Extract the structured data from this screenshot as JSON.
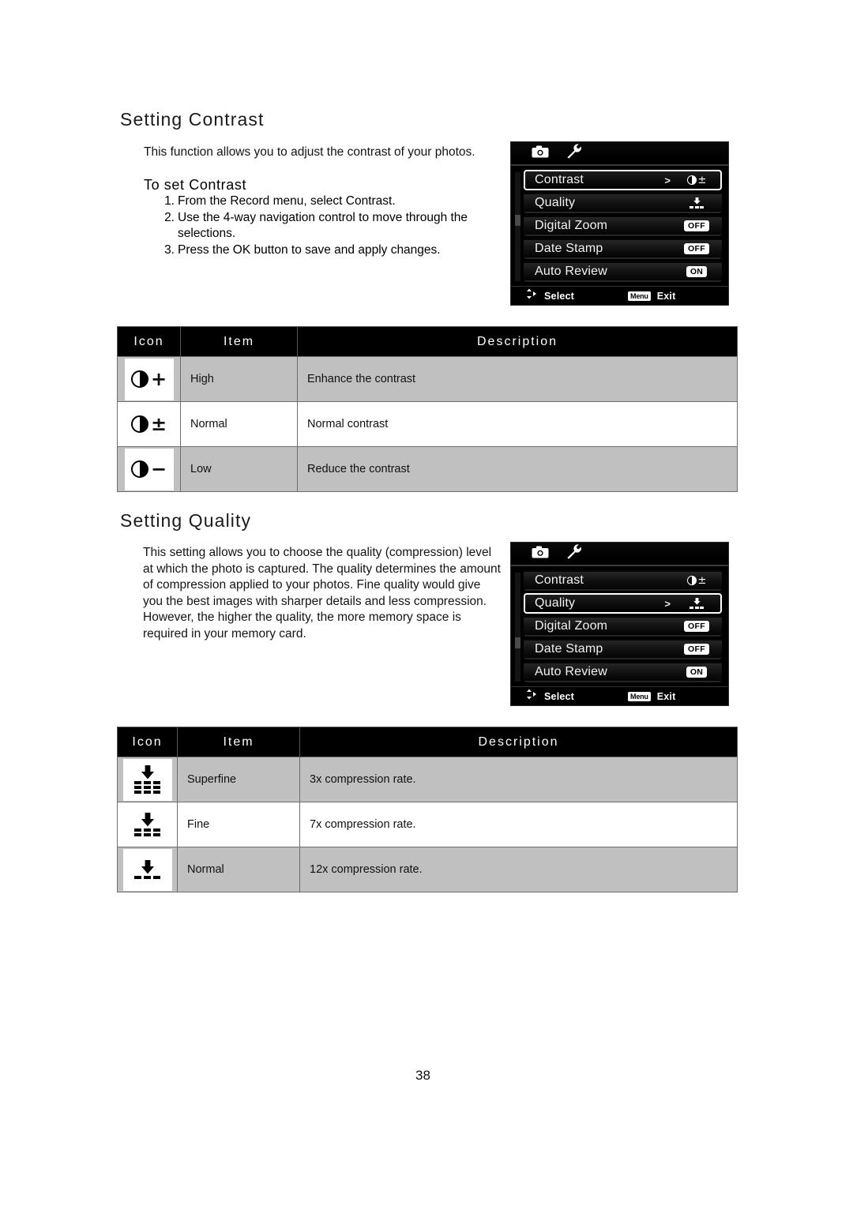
{
  "page": {
    "number": "38"
  },
  "sections": [
    {
      "id": "contrast",
      "heading": "Setting Contrast",
      "intro": "This function allows you to adjust the contrast of your photos.",
      "subheading": "To set Contrast",
      "steps": [
        {
          "num": "1.",
          "text": "From the Record menu, select Contrast."
        },
        {
          "num": "2.",
          "text": "Use the 4-way navigation control to move through the selections."
        },
        {
          "num": "3.",
          "text": "Press the OK button to save and apply changes."
        }
      ]
    },
    {
      "id": "quality",
      "heading": "Setting Quality",
      "intro": "This setting allows you to choose the quality (compression) level at which the photo is captured. The quality determines the amount of compression applied to your photos. Fine quality would give you the best images with sharper details and less compression. However, the higher the quality, the more memory space is required in your memory card."
    }
  ],
  "lcd_menus": [
    {
      "id": "record-menu-contrast",
      "tabs": [
        {
          "icon": "camera-icon",
          "name": "record-tab"
        },
        {
          "icon": "wrench-icon",
          "name": "setup-tab"
        }
      ],
      "rows": [
        {
          "label": "Contrast",
          "selected": true,
          "arrow": ">",
          "value_type": "contrast-icon",
          "value": ""
        },
        {
          "label": "Quality",
          "selected": false,
          "arrow": "",
          "value_type": "quality-icon",
          "value": ""
        },
        {
          "label": "Digital Zoom",
          "selected": false,
          "arrow": "",
          "value_type": "badge",
          "value": "OFF"
        },
        {
          "label": "Date Stamp",
          "selected": false,
          "arrow": "",
          "value_type": "badge",
          "value": "OFF"
        },
        {
          "label": "Auto Review",
          "selected": false,
          "arrow": "",
          "value_type": "badge",
          "value": "ON"
        }
      ],
      "footer": {
        "select_label": "Select",
        "menu_badge": "Menu",
        "exit_label": "Exit"
      }
    },
    {
      "id": "record-menu-quality",
      "tabs": [
        {
          "icon": "camera-icon",
          "name": "record-tab"
        },
        {
          "icon": "wrench-icon",
          "name": "setup-tab"
        }
      ],
      "rows": [
        {
          "label": "Contrast",
          "selected": false,
          "arrow": "",
          "value_type": "contrast-icon",
          "value": ""
        },
        {
          "label": "Quality",
          "selected": true,
          "arrow": ">",
          "value_type": "quality-icon",
          "value": ""
        },
        {
          "label": "Digital Zoom",
          "selected": false,
          "arrow": "",
          "value_type": "badge",
          "value": "OFF"
        },
        {
          "label": "Date Stamp",
          "selected": false,
          "arrow": "",
          "value_type": "badge",
          "value": "OFF"
        },
        {
          "label": "Auto Review",
          "selected": false,
          "arrow": "",
          "value_type": "badge",
          "value": "ON"
        }
      ],
      "footer": {
        "select_label": "Select",
        "menu_badge": "Menu",
        "exit_label": "Exit"
      }
    }
  ],
  "tables": [
    {
      "id": "contrast-table",
      "headers": [
        "Icon",
        "Item",
        "Description"
      ],
      "rows": [
        {
          "icon": "contrast-high-icon",
          "sign": "+",
          "item": "High",
          "description": "Enhance the contrast"
        },
        {
          "icon": "contrast-normal-icon",
          "sign": "±",
          "item": "Normal",
          "description": "Normal contrast"
        },
        {
          "icon": "contrast-low-icon",
          "sign": "−",
          "item": "Low",
          "description": "Reduce the contrast"
        }
      ]
    },
    {
      "id": "quality-table",
      "headers": [
        "Icon",
        "Item",
        "Description"
      ],
      "rows": [
        {
          "icon": "quality-superfine-icon",
          "bars": 3,
          "item": "Superfine",
          "description": "3x compression rate."
        },
        {
          "icon": "quality-fine-icon",
          "bars": 2,
          "item": "Fine",
          "description": "7x compression rate."
        },
        {
          "icon": "quality-normal-icon",
          "bars": 1,
          "item": "Normal",
          "description": "12x compression rate."
        }
      ]
    }
  ],
  "colors": {
    "header_bg": "#000000",
    "row_shade": "#c0c0c0",
    "row_plain": "#ffffff",
    "lcd_bg": "#000000",
    "lcd_text": "#f2f2f2",
    "badge_bg": "#ffffff"
  }
}
